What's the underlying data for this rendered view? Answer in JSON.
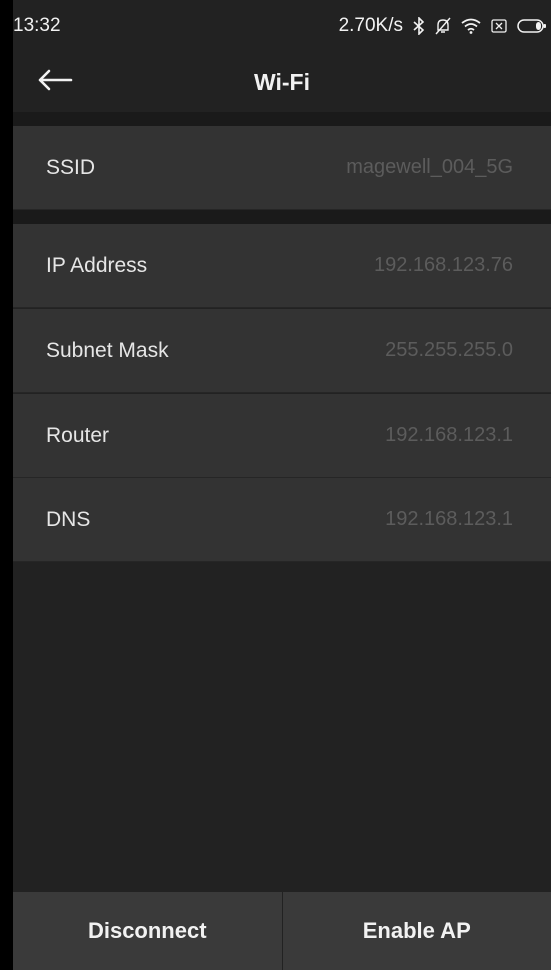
{
  "status_bar": {
    "time": "13:32",
    "net_speed": "2.70K/s",
    "icons": [
      "bluetooth-icon",
      "bell-muted-icon",
      "wifi-icon",
      "sim-icon",
      "battery-icon"
    ]
  },
  "header": {
    "title": "Wi-Fi",
    "back_icon": "arrow-left-icon"
  },
  "ssid_group": [
    {
      "label": "SSID",
      "value": "magewell_004_5G"
    }
  ],
  "network_group": [
    {
      "label": "IP Address",
      "value": "192.168.123.76"
    },
    {
      "label": "Subnet Mask",
      "value": "255.255.255.0"
    },
    {
      "label": "Router",
      "value": "192.168.123.1"
    },
    {
      "label": "DNS",
      "value": "192.168.123.1"
    }
  ],
  "actions": {
    "disconnect": "Disconnect",
    "enable_ap": "Enable AP"
  },
  "colors": {
    "background": "#222222",
    "row": "#333333",
    "value_text": "#5c5c5c",
    "bottom_bar": "#3a3a3a"
  }
}
